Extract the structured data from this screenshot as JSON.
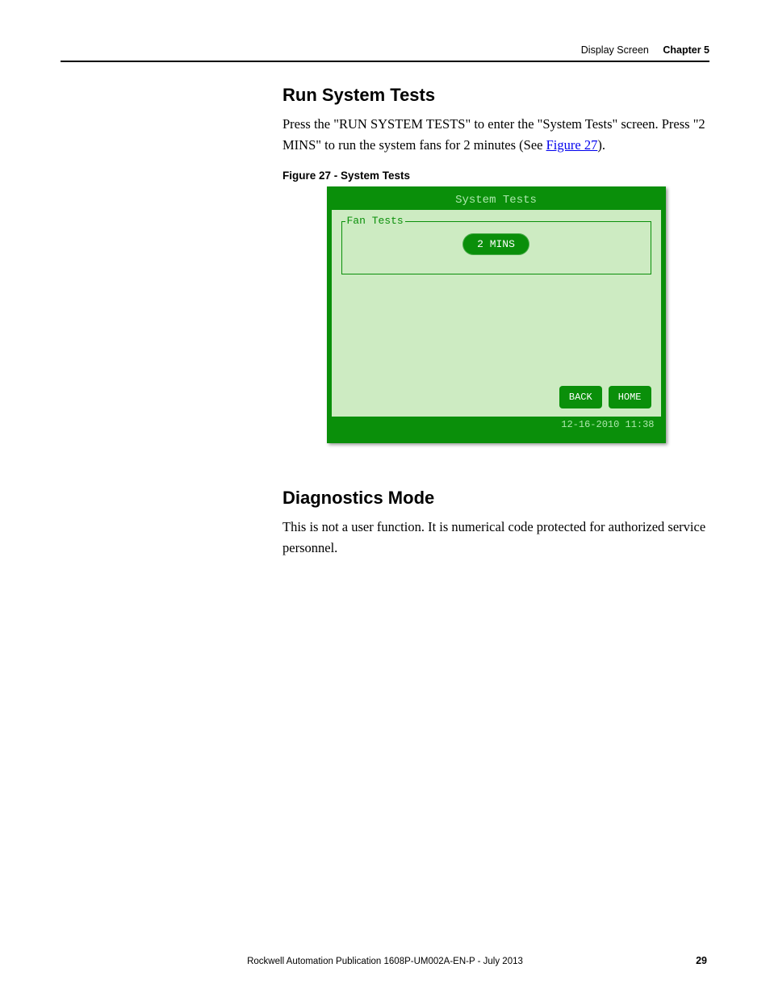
{
  "header": {
    "section": "Display Screen",
    "chapter": "Chapter 5"
  },
  "run_tests": {
    "heading": "Run System Tests",
    "para_a": "Press the \"RUN SYSTEM TESTS\" to enter the \"System Tests\" screen. Press \"2 MINS\" to run the system fans for 2 minutes (See ",
    "link": "Figure 27",
    "para_b": ").",
    "fig_caption": "Figure 27 - System Tests"
  },
  "screen": {
    "title": "System Tests",
    "group_label": "Fan Tests",
    "button_2mins": "2 MINS",
    "back": "BACK",
    "home": "HOME",
    "timestamp": "12-16-2010  11:38"
  },
  "diag": {
    "heading": "Diagnostics Mode",
    "para": "This is not a user function. It is numerical code protected for authorized service personnel."
  },
  "footer": {
    "pub": "Rockwell Automation Publication 1608P-UM002A-EN-P - July 2013",
    "page": "29"
  },
  "chart_data": null
}
